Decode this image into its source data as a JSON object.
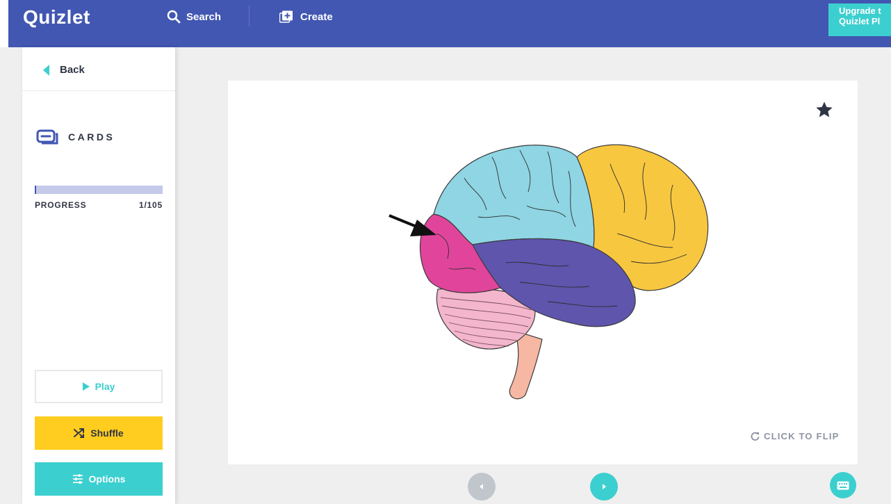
{
  "header": {
    "logo": "Quizlet",
    "search_label": "Search",
    "create_label": "Create",
    "upgrade_line1": "Upgrade t",
    "upgrade_line2": "Quizlet Pl"
  },
  "sidebar": {
    "back_label": "Back",
    "mode_label": "CARDS",
    "progress_label": "PROGRESS",
    "progress_count": "1/105",
    "progress_fraction": 0.0095,
    "play_label": "Play",
    "shuffle_label": "Shuffle",
    "options_label": "Options"
  },
  "card": {
    "flip_hint": "CLICK TO FLIP",
    "image_subject": "brain diagram with arrow pointing to frontal lobe"
  },
  "icons": {
    "search": "search-icon",
    "create": "create-icon",
    "back": "chevron-left-icon",
    "cards": "cards-icon",
    "play": "play-icon",
    "shuffle": "shuffle-icon",
    "options": "sliders-icon",
    "star": "star-icon",
    "flip": "refresh-icon",
    "prev": "prev-arrow-icon",
    "next": "next-arrow-icon",
    "keyboard": "keyboard-icon"
  },
  "colors": {
    "brand": "#4257b2",
    "accent": "#3ccfcf",
    "shuffle": "#ffcd1f",
    "progress_track": "#c5c9ea"
  }
}
